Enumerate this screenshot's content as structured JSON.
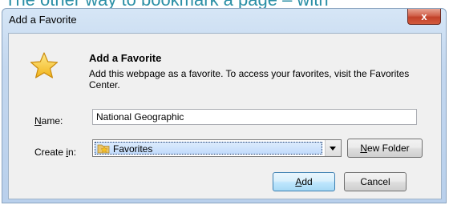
{
  "caption": "The other way to bookmark a page – with",
  "window": {
    "title": "Add a Favorite",
    "close_label": "x"
  },
  "dialog": {
    "heading": "Add a Favorite",
    "description": "Add this webpage as a favorite. To access your favorites, visit the Favorites Center.",
    "icon": "star-icon"
  },
  "form": {
    "name_label_accel": "N",
    "name_label_rest": "ame:",
    "name_value": "National Geographic",
    "create_label_prefix": "Create ",
    "create_label_accel": "i",
    "create_label_suffix": "n:",
    "create_in_value": "Favorites",
    "create_in_icon": "folder-icon"
  },
  "buttons": {
    "new_folder_accel": "N",
    "new_folder_rest": "ew Folder",
    "add_accel": "A",
    "add_rest": "dd",
    "cancel": "Cancel"
  },
  "colors": {
    "caption": "#2b8fa6",
    "close_button": "#c2412a",
    "star": "#f7c51e",
    "default_button_border": "#3c7fb1"
  }
}
